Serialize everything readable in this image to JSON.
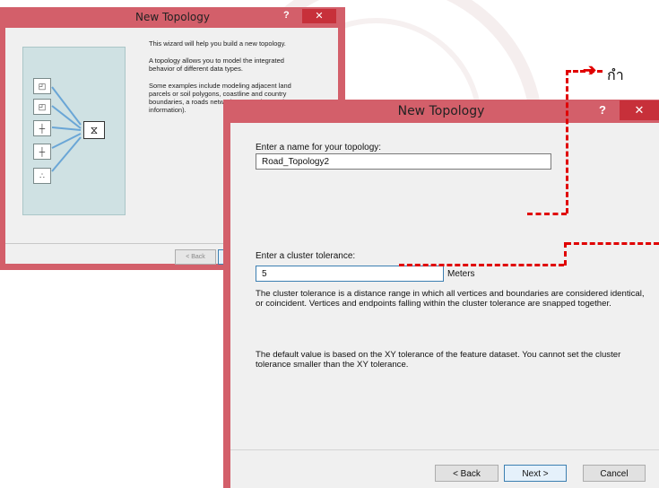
{
  "background": {
    "accent": "#e00000",
    "titlebar": "#d35f6a",
    "close": "#c7303a"
  },
  "annotation": {
    "thai_text": "กำ",
    "arrow": "➔"
  },
  "wizard_intro": {
    "title": "New Topology",
    "help": "?",
    "close": "✕",
    "paragraphs": [
      "This wizard will help you build a new topology.",
      "A topology allows you to model the integrated behavior of different data types.",
      "Some examples include modeling adjacent land parcels or soil polygons, coastline and country boundaries, a roads network, ro... and nested geogr... information)."
    ],
    "back_label": "< Back",
    "art_icons": [
      "polygon-icon",
      "polygon-icon",
      "line-icon",
      "line-icon",
      "point-icon",
      "topology-node-icon"
    ]
  },
  "wizard_main": {
    "title": "New Topology",
    "help": "?",
    "close": "✕",
    "name_label": "Enter a name for your topology:",
    "name_value": "Road_Topology2",
    "tolerance_label": "Enter a cluster tolerance:",
    "tolerance_value": "5",
    "tolerance_unit": "Meters",
    "para1": "The cluster tolerance is a distance range in which all vertices and boundaries are considered identical, or coincident. Vertices and endpoints falling within the cluster tolerance are snapped together.",
    "para2": "The default value is based on the XY tolerance of the feature dataset. You cannot set the cluster tolerance smaller than the XY tolerance.",
    "back_label": "< Back",
    "next_label": "Next >",
    "cancel_label": "Cancel"
  }
}
